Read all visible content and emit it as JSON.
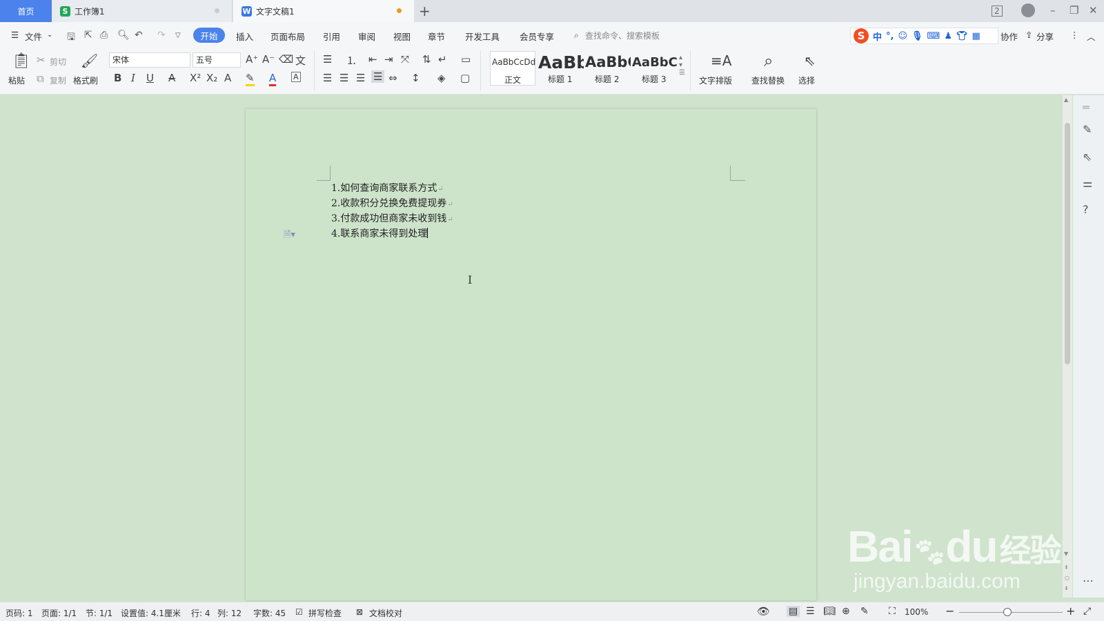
{
  "tabs": {
    "home": "首页",
    "sheet": "工作簿1",
    "doc": "文字文稿1",
    "add": "+"
  },
  "window": {
    "badge": "2"
  },
  "menu": {
    "file": "文件",
    "start": "开始",
    "insert": "插入",
    "layout": "页面布局",
    "reference": "引用",
    "review": "审阅",
    "view": "视图",
    "chapter": "章节",
    "dev": "开发工具",
    "member": "会员专享",
    "search_placeholder": "查找命令、搜索模板",
    "collab": "协作",
    "share": "分享"
  },
  "ime": {
    "logo": "S",
    "lang": "中"
  },
  "ribbon": {
    "paste": "粘贴",
    "cut": "剪切",
    "copy": "复制",
    "format_painter": "格式刷",
    "font": "宋体",
    "size": "五号",
    "style_normal_sample": "AaBbCcDd",
    "style_normal": "正文",
    "style_h1_sample": "AaBb",
    "style_h1": "标题 1",
    "style_h2_sample": "AaBbC",
    "style_h2": "标题 2",
    "style_h3_sample": "AaBbC",
    "style_h3": "标题 3",
    "text_layout": "文字排版",
    "find_replace": "查找替换",
    "select": "选择"
  },
  "document": {
    "lines": [
      "1.如何查询商家联系方式",
      "2.收款积分兑换免费提现券",
      "3.付款成功但商家未收到钱",
      "4.联系商家未得到处理"
    ]
  },
  "status": {
    "page_code": "页码: 1",
    "page": "页面: 1/1",
    "section": "节: 1/1",
    "setting": "设置值: 4.1厘米",
    "row": "行: 4",
    "col": "列: 12",
    "word_count": "字数: 45",
    "spell": "拼写检查",
    "proofread": "文档校对",
    "zoom": "100%"
  },
  "watermark": {
    "brand": "Bai",
    "paw_text": "du",
    "jy": "经验",
    "url": "jingyan.baidu.com"
  },
  "colors": {
    "accent": "#4b82ec",
    "page_bg": "#cde4cb",
    "sheet_icon": "#22a65a",
    "doc_icon": "#3a78e0"
  }
}
